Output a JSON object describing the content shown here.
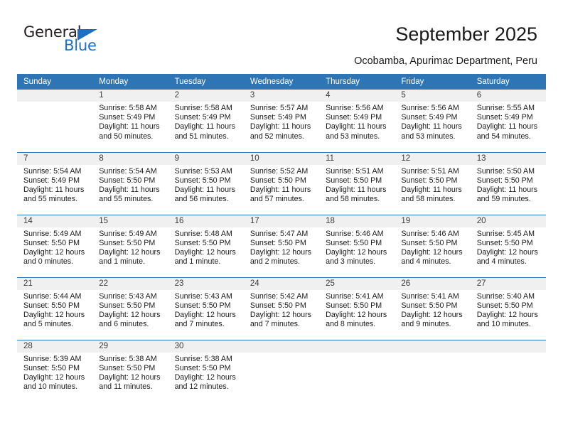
{
  "brand": {
    "name_part1": "General",
    "name_part2": "Blue",
    "accent_color": "#1f6fc0"
  },
  "header": {
    "title": "September 2025",
    "subtitle": "Ocobamba, Apurimac Department, Peru",
    "header_bg_color": "#2e75b6"
  },
  "calendar": {
    "weekday_headers": [
      "Sunday",
      "Monday",
      "Tuesday",
      "Wednesday",
      "Thursday",
      "Friday",
      "Saturday"
    ],
    "weeks": [
      [
        {
          "day": "",
          "sunrise": "",
          "sunset": "",
          "daylight1": "",
          "daylight2": "",
          "empty": true
        },
        {
          "day": "1",
          "sunrise": "Sunrise: 5:58 AM",
          "sunset": "Sunset: 5:49 PM",
          "daylight1": "Daylight: 11 hours",
          "daylight2": "and 50 minutes."
        },
        {
          "day": "2",
          "sunrise": "Sunrise: 5:58 AM",
          "sunset": "Sunset: 5:49 PM",
          "daylight1": "Daylight: 11 hours",
          "daylight2": "and 51 minutes."
        },
        {
          "day": "3",
          "sunrise": "Sunrise: 5:57 AM",
          "sunset": "Sunset: 5:49 PM",
          "daylight1": "Daylight: 11 hours",
          "daylight2": "and 52 minutes."
        },
        {
          "day": "4",
          "sunrise": "Sunrise: 5:56 AM",
          "sunset": "Sunset: 5:49 PM",
          "daylight1": "Daylight: 11 hours",
          "daylight2": "and 53 minutes."
        },
        {
          "day": "5",
          "sunrise": "Sunrise: 5:56 AM",
          "sunset": "Sunset: 5:49 PM",
          "daylight1": "Daylight: 11 hours",
          "daylight2": "and 53 minutes."
        },
        {
          "day": "6",
          "sunrise": "Sunrise: 5:55 AM",
          "sunset": "Sunset: 5:49 PM",
          "daylight1": "Daylight: 11 hours",
          "daylight2": "and 54 minutes."
        }
      ],
      [
        {
          "day": "7",
          "sunrise": "Sunrise: 5:54 AM",
          "sunset": "Sunset: 5:49 PM",
          "daylight1": "Daylight: 11 hours",
          "daylight2": "and 55 minutes."
        },
        {
          "day": "8",
          "sunrise": "Sunrise: 5:54 AM",
          "sunset": "Sunset: 5:50 PM",
          "daylight1": "Daylight: 11 hours",
          "daylight2": "and 55 minutes."
        },
        {
          "day": "9",
          "sunrise": "Sunrise: 5:53 AM",
          "sunset": "Sunset: 5:50 PM",
          "daylight1": "Daylight: 11 hours",
          "daylight2": "and 56 minutes."
        },
        {
          "day": "10",
          "sunrise": "Sunrise: 5:52 AM",
          "sunset": "Sunset: 5:50 PM",
          "daylight1": "Daylight: 11 hours",
          "daylight2": "and 57 minutes."
        },
        {
          "day": "11",
          "sunrise": "Sunrise: 5:51 AM",
          "sunset": "Sunset: 5:50 PM",
          "daylight1": "Daylight: 11 hours",
          "daylight2": "and 58 minutes."
        },
        {
          "day": "12",
          "sunrise": "Sunrise: 5:51 AM",
          "sunset": "Sunset: 5:50 PM",
          "daylight1": "Daylight: 11 hours",
          "daylight2": "and 58 minutes."
        },
        {
          "day": "13",
          "sunrise": "Sunrise: 5:50 AM",
          "sunset": "Sunset: 5:50 PM",
          "daylight1": "Daylight: 11 hours",
          "daylight2": "and 59 minutes."
        }
      ],
      [
        {
          "day": "14",
          "sunrise": "Sunrise: 5:49 AM",
          "sunset": "Sunset: 5:50 PM",
          "daylight1": "Daylight: 12 hours",
          "daylight2": "and 0 minutes."
        },
        {
          "day": "15",
          "sunrise": "Sunrise: 5:49 AM",
          "sunset": "Sunset: 5:50 PM",
          "daylight1": "Daylight: 12 hours",
          "daylight2": "and 1 minute."
        },
        {
          "day": "16",
          "sunrise": "Sunrise: 5:48 AM",
          "sunset": "Sunset: 5:50 PM",
          "daylight1": "Daylight: 12 hours",
          "daylight2": "and 1 minute."
        },
        {
          "day": "17",
          "sunrise": "Sunrise: 5:47 AM",
          "sunset": "Sunset: 5:50 PM",
          "daylight1": "Daylight: 12 hours",
          "daylight2": "and 2 minutes."
        },
        {
          "day": "18",
          "sunrise": "Sunrise: 5:46 AM",
          "sunset": "Sunset: 5:50 PM",
          "daylight1": "Daylight: 12 hours",
          "daylight2": "and 3 minutes."
        },
        {
          "day": "19",
          "sunrise": "Sunrise: 5:46 AM",
          "sunset": "Sunset: 5:50 PM",
          "daylight1": "Daylight: 12 hours",
          "daylight2": "and 4 minutes."
        },
        {
          "day": "20",
          "sunrise": "Sunrise: 5:45 AM",
          "sunset": "Sunset: 5:50 PM",
          "daylight1": "Daylight: 12 hours",
          "daylight2": "and 4 minutes."
        }
      ],
      [
        {
          "day": "21",
          "sunrise": "Sunrise: 5:44 AM",
          "sunset": "Sunset: 5:50 PM",
          "daylight1": "Daylight: 12 hours",
          "daylight2": "and 5 minutes."
        },
        {
          "day": "22",
          "sunrise": "Sunrise: 5:43 AM",
          "sunset": "Sunset: 5:50 PM",
          "daylight1": "Daylight: 12 hours",
          "daylight2": "and 6 minutes."
        },
        {
          "day": "23",
          "sunrise": "Sunrise: 5:43 AM",
          "sunset": "Sunset: 5:50 PM",
          "daylight1": "Daylight: 12 hours",
          "daylight2": "and 7 minutes."
        },
        {
          "day": "24",
          "sunrise": "Sunrise: 5:42 AM",
          "sunset": "Sunset: 5:50 PM",
          "daylight1": "Daylight: 12 hours",
          "daylight2": "and 7 minutes."
        },
        {
          "day": "25",
          "sunrise": "Sunrise: 5:41 AM",
          "sunset": "Sunset: 5:50 PM",
          "daylight1": "Daylight: 12 hours",
          "daylight2": "and 8 minutes."
        },
        {
          "day": "26",
          "sunrise": "Sunrise: 5:41 AM",
          "sunset": "Sunset: 5:50 PM",
          "daylight1": "Daylight: 12 hours",
          "daylight2": "and 9 minutes."
        },
        {
          "day": "27",
          "sunrise": "Sunrise: 5:40 AM",
          "sunset": "Sunset: 5:50 PM",
          "daylight1": "Daylight: 12 hours",
          "daylight2": "and 10 minutes."
        }
      ],
      [
        {
          "day": "28",
          "sunrise": "Sunrise: 5:39 AM",
          "sunset": "Sunset: 5:50 PM",
          "daylight1": "Daylight: 12 hours",
          "daylight2": "and 10 minutes."
        },
        {
          "day": "29",
          "sunrise": "Sunrise: 5:38 AM",
          "sunset": "Sunset: 5:50 PM",
          "daylight1": "Daylight: 12 hours",
          "daylight2": "and 11 minutes."
        },
        {
          "day": "30",
          "sunrise": "Sunrise: 5:38 AM",
          "sunset": "Sunset: 5:50 PM",
          "daylight1": "Daylight: 12 hours",
          "daylight2": "and 12 minutes."
        },
        {
          "day": "",
          "sunrise": "",
          "sunset": "",
          "daylight1": "",
          "daylight2": "",
          "empty": true
        },
        {
          "day": "",
          "sunrise": "",
          "sunset": "",
          "daylight1": "",
          "daylight2": "",
          "empty": true
        },
        {
          "day": "",
          "sunrise": "",
          "sunset": "",
          "daylight1": "",
          "daylight2": "",
          "empty": true
        },
        {
          "day": "",
          "sunrise": "",
          "sunset": "",
          "daylight1": "",
          "daylight2": "",
          "empty": true
        }
      ]
    ]
  }
}
